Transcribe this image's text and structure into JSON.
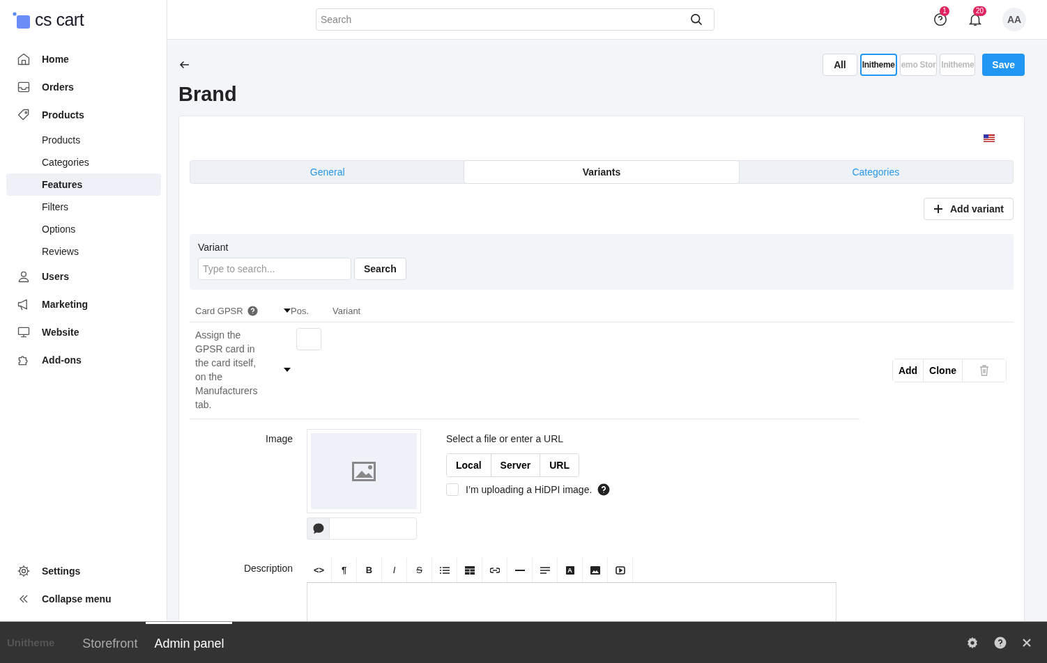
{
  "logo": {
    "text": "cs cart"
  },
  "sidebar": {
    "items": [
      {
        "label": "Home",
        "selected": false
      },
      {
        "label": "Orders",
        "selected": false
      },
      {
        "label": "Products",
        "selected": false,
        "children": [
          {
            "label": "Products",
            "selected": false
          },
          {
            "label": "Categories",
            "selected": false
          },
          {
            "label": "Features",
            "selected": true
          },
          {
            "label": "Filters",
            "selected": false
          },
          {
            "label": "Options",
            "selected": false
          },
          {
            "label": "Reviews",
            "selected": false
          }
        ]
      },
      {
        "label": "Users",
        "selected": false
      },
      {
        "label": "Marketing",
        "selected": false
      },
      {
        "label": "Website",
        "selected": false
      },
      {
        "label": "Add-ons",
        "selected": false
      }
    ],
    "footer": [
      {
        "label": "Settings"
      },
      {
        "label": "Collapse menu"
      }
    ]
  },
  "header": {
    "search": {
      "placeholder": "Search"
    },
    "help_badge": "1",
    "notifications_badge": "20",
    "avatar": "AA"
  },
  "page": {
    "title": "Brand",
    "storefronts": [
      {
        "label": "All",
        "selected": false,
        "disabled": false
      },
      {
        "label": "Initheme",
        "selected": true,
        "disabled": false
      },
      {
        "label": "emo Stor",
        "selected": false,
        "disabled": true
      },
      {
        "label": "Initheme",
        "selected": false,
        "disabled": true
      }
    ],
    "save": "Save"
  },
  "tabs": [
    {
      "label": "General",
      "selected": false
    },
    {
      "label": "Variants",
      "selected": true
    },
    {
      "label": "Categories",
      "selected": false
    }
  ],
  "add_variant": "Add variant",
  "filter": {
    "label": "Variant",
    "placeholder": "Type to search...",
    "button": "Search"
  },
  "table": {
    "columns": [
      "Card GPSR",
      "Pos.",
      "Variant"
    ],
    "rows": [
      {
        "gpsr": "Assign the GPSR card in the card itself, on the Manufacturers tab.",
        "actions": [
          "Add",
          "Clone"
        ]
      }
    ]
  },
  "image": {
    "label": "Image",
    "prompt": "Select a file or enter a URL",
    "sources": [
      "Local",
      "Server",
      "URL"
    ],
    "hidpi": {
      "label": "I’m uploading a HiDPI image.",
      "checked": false
    }
  },
  "description": {
    "label": "Description",
    "toolbar": [
      {
        "kind": "code",
        "glyph": "<>"
      },
      {
        "kind": "paragraph",
        "glyph": "¶"
      },
      {
        "kind": "bold",
        "glyph": "B"
      },
      {
        "kind": "italic",
        "glyph": "I"
      },
      {
        "kind": "strike",
        "glyph": "S"
      },
      {
        "kind": "list"
      },
      {
        "kind": "table"
      },
      {
        "kind": "link"
      },
      {
        "kind": "rule"
      },
      {
        "kind": "align"
      },
      {
        "kind": "color",
        "glyph": "A"
      },
      {
        "kind": "image"
      },
      {
        "kind": "video"
      }
    ]
  },
  "bottom_bar": {
    "logo": "Unitheme",
    "tabs": [
      {
        "label": "Storefront",
        "selected": false
      },
      {
        "label": "Admin panel",
        "selected": true
      }
    ]
  }
}
